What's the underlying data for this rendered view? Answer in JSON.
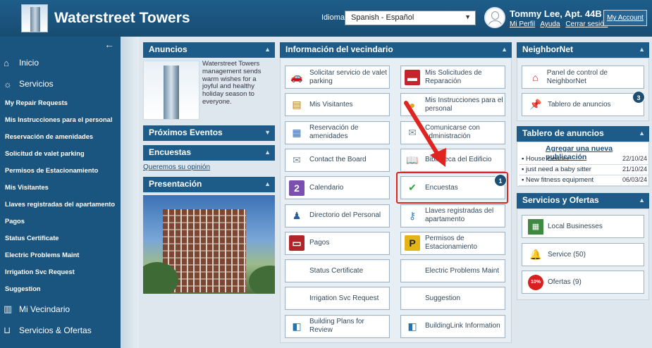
{
  "header": {
    "site_title": "Waterstreet Towers",
    "language_label": "Idioma:",
    "language_value": "Spanish - Español",
    "user_name": "Tommy Lee, Apt. 44B",
    "links": [
      "Mi Perfil",
      "Ayuda",
      "Cerrar sesión"
    ],
    "my_account": "My Account"
  },
  "sidebar": {
    "main": [
      {
        "label": "Inicio",
        "icon": "home-icon"
      },
      {
        "label": "Servicios",
        "icon": "services-icon"
      }
    ],
    "sub_items": [
      "My Repair Requests",
      "Mis Instrucciones para el personal",
      "Reservación de amenidades",
      "Solicitud de valet parking",
      "Permisos de Estacionamiento",
      "Mis Visitantes",
      "Llaves registradas del apartamento",
      "Pagos",
      "Status Certificate",
      "Electric Problems Maint",
      "Irrigation Svc Request",
      "Suggestion"
    ],
    "bottom": [
      {
        "label": "Mi Vecindario",
        "icon": "building-icon"
      },
      {
        "label": "Servicios & Ofertas",
        "icon": "basket-icon"
      }
    ]
  },
  "anuncios": {
    "title": "Anuncios",
    "text": "Waterstreet Towers management sends warm wishes for a joyful and healthy holiday season to everyone."
  },
  "eventos": {
    "title": "Próximos Eventos"
  },
  "encuestas": {
    "title": "Encuestas",
    "link": "Queremos su opinión"
  },
  "presentacion": {
    "title": "Presentación"
  },
  "vecindario": {
    "title": "Información del vecindario",
    "tiles": [
      {
        "label": "Solicitar servicio de valet parking",
        "icon": "car-icon",
        "color": "#2f7a3a"
      },
      {
        "label": "Mis Solicitudes de Reparación",
        "icon": "toolbox-icon",
        "color": "#c4242b"
      },
      {
        "label": "Mis Visitantes",
        "icon": "visitors-icon",
        "color": "#b07a2a"
      },
      {
        "label": "Mis Instrucciones para el personal",
        "icon": "pin-icon",
        "color": "#d9a81e"
      },
      {
        "label": "Reservación de amenidades",
        "icon": "calendar-grid-icon",
        "color": "#3b6aa8"
      },
      {
        "label": "Comunicarse con administración",
        "icon": "envelope-icon",
        "color": "#7d8e9c"
      },
      {
        "label": "Contact the Board",
        "icon": "envelope-icon",
        "color": "#7d8e9c"
      },
      {
        "label": "Biblioteca del Edificio",
        "icon": "book-icon",
        "color": "#8a5a3a"
      },
      {
        "label": "Calendario",
        "icon": "calendar-icon",
        "color": "#7a4fb0"
      },
      {
        "label": "Encuestas",
        "icon": "checkmark-icon",
        "color": "#2ea33a"
      },
      {
        "label": "Directorio del Personal",
        "icon": "person-icon",
        "color": "#2a5e9a"
      },
      {
        "label": "Llaves registradas del apartamento",
        "icon": "key-icon",
        "color": "#2a86c8"
      },
      {
        "label": "Pagos",
        "icon": "card-icon",
        "color": "#b3242a"
      },
      {
        "label": "Permisos de Estacionamiento",
        "icon": "parking-icon",
        "color": "#e2b417"
      },
      {
        "label": "Status Certificate",
        "icon": "",
        "color": ""
      },
      {
        "label": "Electric Problems Maint",
        "icon": "",
        "color": ""
      },
      {
        "label": "Irrigation Svc Request",
        "icon": "",
        "color": ""
      },
      {
        "label": "Suggestion",
        "icon": "",
        "color": ""
      },
      {
        "label": "Building Plans for Review",
        "icon": "cube-icon",
        "color": "#2a6fb0"
      },
      {
        "label": "BuildingLink Information",
        "icon": "cube-icon",
        "color": "#2a6fb0"
      }
    ],
    "encuestas_badge": "1"
  },
  "neighbornet": {
    "title": "NeighborNet",
    "tiles": [
      {
        "label": "Panel de control de NeighborNet",
        "icon": "house-icon"
      },
      {
        "label": "Tablero de anuncios",
        "icon": "pushpin-icon"
      }
    ],
    "tablero_badge": "3"
  },
  "tablero": {
    "title": "Tablero de anuncios",
    "add_link": "Agregar una nueva publicación",
    "rows": [
      {
        "text": "House cleaner",
        "date": "22/10/24"
      },
      {
        "text": "just need a baby sitter",
        "date": "21/10/24"
      },
      {
        "text": "New fitness equipment",
        "date": "06/03/24"
      }
    ]
  },
  "ofertas": {
    "title": "Servicios y Ofertas",
    "tiles": [
      {
        "label": "Local Businesses",
        "icon": "shops-icon"
      },
      {
        "label": "Service (50)",
        "icon": "bell-icon"
      },
      {
        "label": "Ofertas (9)",
        "icon": "discount-icon"
      }
    ],
    "discount_text": "10%"
  }
}
